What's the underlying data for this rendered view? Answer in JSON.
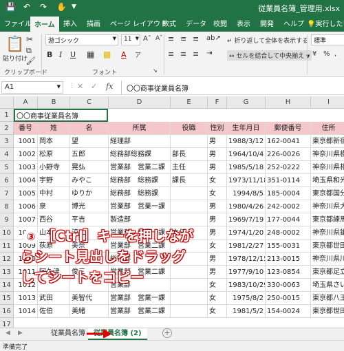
{
  "app": {
    "title": "従業員名簿_管理用.xlsx",
    "accent": "#217346",
    "header_fill": "#f4c7ca",
    "overlay_color": "#c00000",
    "qat_icons": [
      "save-icon",
      "undo-icon",
      "redo-icon",
      "touch-mode-icon",
      "customize-icon"
    ]
  },
  "ribbon": {
    "tabs": [
      "ファイル",
      "ホーム",
      "挿入",
      "描画",
      "ページ レイアウト",
      "数式",
      "データ",
      "校閲",
      "表示",
      "開発",
      "ヘルプ",
      "実行したい"
    ],
    "active_tab": "ホーム",
    "clipboard": {
      "paste_label": "貼り付け",
      "group_label": "クリップボード"
    },
    "font": {
      "font_name": "游ゴシック",
      "font_size": "11",
      "group_label": "フォント",
      "bold": "B",
      "italic": "I",
      "underline": "U"
    },
    "alignment": {
      "wrap_label": "折り返して全体を表示する",
      "merge_label": "セルを結合して中央揃え"
    },
    "number": {
      "format": "標準",
      "percent": "%"
    }
  },
  "formula_bar": {
    "name_box": "A1",
    "fx": "fx",
    "content": "〇〇商事従業員名簿"
  },
  "columns": [
    "A",
    "B",
    "C",
    "D",
    "E",
    "F",
    "G",
    "H",
    "I"
  ],
  "rows": [
    "1",
    "2",
    "3",
    "4",
    "5",
    "6",
    "7",
    "8",
    "9",
    "10",
    "11",
    "12",
    "13",
    "14",
    "15",
    "16",
    "17"
  ],
  "sheet": {
    "title": "〇〇商事従業員名簿",
    "headers": [
      "番号",
      "姓",
      "名",
      "所属",
      "役職",
      "性別",
      "生年月日",
      "郵便番号",
      "住所"
    ],
    "data": [
      [
        "1001",
        "岡本",
        "望",
        "経理部",
        "",
        "男",
        "1988/3/12",
        "162-0041",
        "東京都新宿"
      ],
      [
        "1002",
        "松原",
        "五郎",
        "総務部総務課",
        "部長",
        "男",
        "1964/10/4",
        "226-0026",
        "神奈川県横"
      ],
      [
        "1003",
        "小野寺",
        "晃弘",
        "営業部　営業二課",
        "主任",
        "男",
        "1985/5/18",
        "252-0222",
        "神奈川県相"
      ],
      [
        "1004",
        "宇野",
        "みやこ",
        "総務部　総務課",
        "課長",
        "女",
        "1973/11/18",
        "351-0114",
        "埼玉県和光"
      ],
      [
        "1005",
        "中村",
        "ゆりか",
        "総務部　総務課",
        "",
        "女",
        "1994/8/5",
        "185-0004",
        "東京都国分"
      ],
      [
        "1006",
        "泉",
        "博光",
        "営業部　営業一課",
        "",
        "男",
        "1980/4/26",
        "242-0002",
        "神奈川県大"
      ],
      [
        "1007",
        "西谷",
        "平吉",
        "製造部",
        "",
        "男",
        "1969/7/19",
        "177-0044",
        "東京都練馬"
      ],
      [
        "1008",
        "山本",
        "涼二",
        "営業部　営業一課",
        "主任",
        "男",
        "1974/1/20",
        "248-0002",
        "神奈川県鎌"
      ],
      [
        "1009",
        "荻原",
        "美奈",
        "営業部　営業二課",
        "",
        "女",
        "1981/2/27",
        "155-0031",
        "東京都世田"
      ],
      [
        "1010",
        "",
        "",
        "総務部",
        "",
        "男",
        "1978/12/15",
        "213-0015",
        "神奈川県川"
      ],
      [
        "1011",
        "阿久津",
        "俊三",
        "営業部　営業二課",
        "",
        "男",
        "1977/9/10",
        "123-0854",
        "東京都足立"
      ],
      [
        "1012",
        "",
        "",
        "営業部",
        "",
        "女",
        "1983/10/29",
        "330-0063",
        "埼玉県さい"
      ],
      [
        "1013",
        "武田",
        "美智代",
        "営業部　営業一課",
        "",
        "女",
        "1975/8/2",
        "250-0015",
        "東京都八王"
      ],
      [
        "1014",
        "佐伯",
        "美緒",
        "営業部　営業二課",
        "",
        "女",
        "1981/5/2",
        "154-0024",
        "東京都世田"
      ]
    ]
  },
  "overlay": {
    "badge": "③",
    "line1": "［Ctrl］キーを押しなが",
    "line2": "らシート見出しをドラッグ",
    "line3": "してシートをコピー"
  },
  "sheet_tabs": [
    "従業員名簿",
    "従業員名簿 (2)"
  ],
  "status": {
    "ready": "準備完了"
  }
}
